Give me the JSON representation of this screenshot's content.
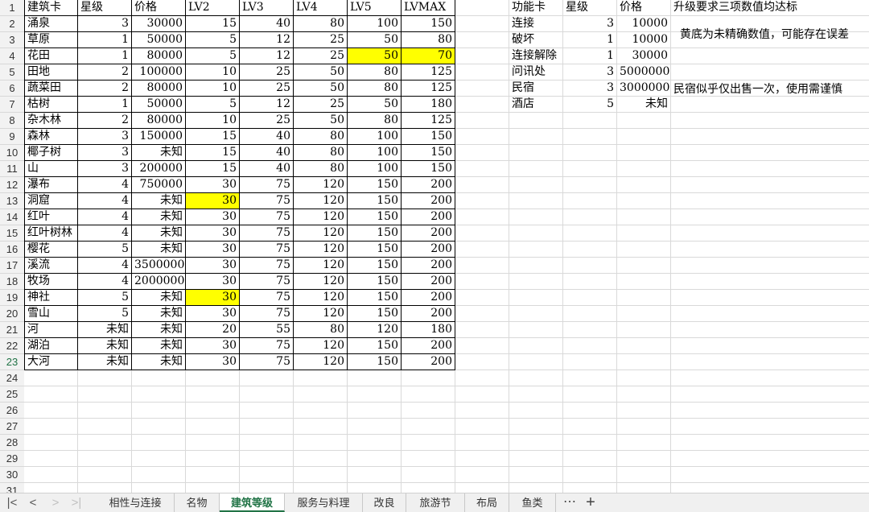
{
  "sheet": {
    "header_row": [
      [
        "建筑卡",
        "星级",
        "价格",
        "LV2",
        "LV3",
        "LV4",
        "LV5",
        "LVMAX"
      ],
      [
        "功能卡",
        "星级",
        "价格",
        "升级要求三项数值均达标"
      ]
    ],
    "buildings": [
      [
        "涌泉",
        "3",
        "30000",
        "15",
        "40",
        "80",
        "100",
        "150"
      ],
      [
        "草原",
        "1",
        "50000",
        "5",
        "12",
        "25",
        "50",
        "80"
      ],
      [
        "花田",
        "1",
        "80000",
        "5",
        "12",
        "25",
        "50",
        "70"
      ],
      [
        "田地",
        "2",
        "100000",
        "10",
        "25",
        "50",
        "80",
        "125"
      ],
      [
        "蔬菜田",
        "2",
        "80000",
        "10",
        "25",
        "50",
        "80",
        "125"
      ],
      [
        "枯树",
        "1",
        "50000",
        "5",
        "12",
        "25",
        "50",
        "180"
      ],
      [
        "杂木林",
        "2",
        "80000",
        "10",
        "25",
        "50",
        "80",
        "125"
      ],
      [
        "森林",
        "3",
        "150000",
        "15",
        "40",
        "80",
        "100",
        "150"
      ],
      [
        "椰子树",
        "3",
        "未知",
        "15",
        "40",
        "80",
        "100",
        "150"
      ],
      [
        "山",
        "3",
        "200000",
        "15",
        "40",
        "80",
        "100",
        "150"
      ],
      [
        "瀑布",
        "4",
        "750000",
        "30",
        "75",
        "120",
        "150",
        "200"
      ],
      [
        "洞窟",
        "4",
        "未知",
        "30",
        "75",
        "120",
        "150",
        "200"
      ],
      [
        "红叶",
        "4",
        "未知",
        "30",
        "75",
        "120",
        "150",
        "200"
      ],
      [
        "红叶树林",
        "4",
        "未知",
        "30",
        "75",
        "120",
        "150",
        "200"
      ],
      [
        "樱花",
        "5",
        "未知",
        "30",
        "75",
        "120",
        "150",
        "200"
      ],
      [
        "溪流",
        "4",
        "3500000",
        "30",
        "75",
        "120",
        "150",
        "200"
      ],
      [
        "牧场",
        "4",
        "2000000",
        "30",
        "75",
        "120",
        "150",
        "200"
      ],
      [
        "神社",
        "5",
        "未知",
        "30",
        "75",
        "120",
        "150",
        "200"
      ],
      [
        "雪山",
        "5",
        "未知",
        "30",
        "75",
        "120",
        "150",
        "200"
      ],
      [
        "河",
        "未知",
        "未知",
        "20",
        "55",
        "80",
        "120",
        "180"
      ],
      [
        "湖泊",
        "未知",
        "未知",
        "30",
        "75",
        "120",
        "150",
        "200"
      ],
      [
        "大河",
        "未知",
        "未知",
        "30",
        "75",
        "120",
        "150",
        "200"
      ]
    ],
    "function_cards": [
      [
        "连接",
        "3",
        "10000"
      ],
      [
        "破坏",
        "1",
        "10000"
      ],
      [
        "连接解除",
        "1",
        "30000"
      ],
      [
        "问讯处",
        "3",
        "5000000"
      ],
      [
        "民宿",
        "3",
        "3000000"
      ],
      [
        "酒店",
        "5",
        "未知"
      ]
    ],
    "notes": {
      "yellow_note": "黄底为未精确数值，可能存在误差",
      "inn_note": "民宿似乎仅出售一次，使用需谨慎"
    },
    "highlighted_cells": [
      "G4",
      "H4",
      "D13",
      "D19"
    ],
    "highlight_color": "#ffff00",
    "row_numbers": [
      "1",
      "2",
      "3",
      "4",
      "5",
      "6",
      "7",
      "8",
      "9",
      "10",
      "11",
      "12",
      "13",
      "14",
      "15",
      "16",
      "17",
      "18",
      "19",
      "20",
      "21",
      "22",
      "23",
      "24",
      "25",
      "26",
      "27",
      "28",
      "29",
      "30",
      "31"
    ],
    "selected_row": "23"
  },
  "tabs": {
    "items": [
      "相性与连接",
      "名物",
      "建筑等级",
      "服务与料理",
      "改良",
      "旅游节",
      "布局",
      "鱼类"
    ],
    "active": "建筑等级",
    "more": "⋯",
    "add": "+",
    "nav_first": "|<",
    "nav_prev": "<",
    "nav_next": ">",
    "nav_last": ">|",
    "accent_color": "#217346"
  }
}
